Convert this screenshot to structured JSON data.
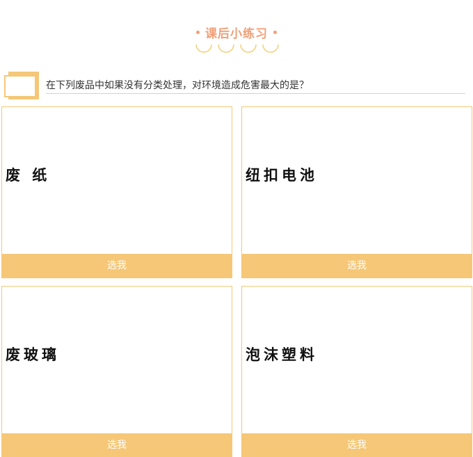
{
  "header": {
    "title": "课后小练习",
    "decor_icon": "arc-decoration-icon"
  },
  "question": {
    "icon": "question-card-icon",
    "text": "在下列废品中如果没有分类处理，对环境造成危害最大的是？"
  },
  "options": [
    {
      "label": "废 纸",
      "button_label": "选我"
    },
    {
      "label": "纽扣电池",
      "button_label": "选我"
    },
    {
      "label": "废玻璃",
      "button_label": "选我"
    },
    {
      "label": "泡沫塑料",
      "button_label": "选我"
    }
  ],
  "colors": {
    "accent": "#f5c776",
    "title": "#f0a078",
    "text": "#333333"
  }
}
